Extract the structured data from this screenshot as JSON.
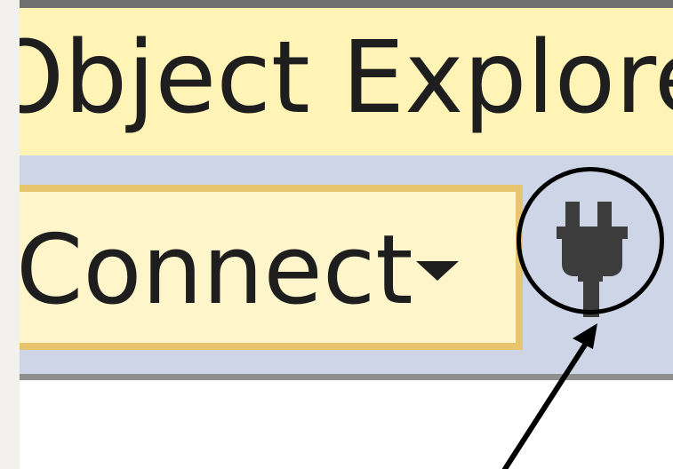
{
  "panel": {
    "title": "Object Explorer"
  },
  "toolbar": {
    "connect_label": "Connect",
    "connect_dropdown_icon": "caret-down-icon",
    "disconnect_icon": "plug-icon"
  },
  "annotation": {
    "circle_color": "#000000",
    "arrow_color": "#000000"
  },
  "colors": {
    "title_bar_bg": "#fff3b6",
    "toolbar_bg": "#cdd5e6",
    "button_bg": "#fff5ca",
    "button_border": "#e9c46f",
    "text": "#1e1e1e",
    "icon": "#3c3c3c"
  }
}
